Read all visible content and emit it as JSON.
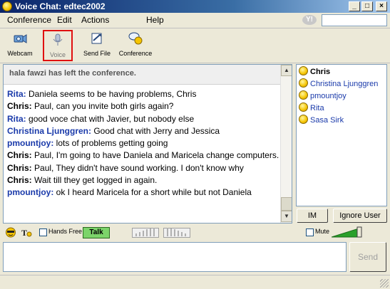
{
  "window": {
    "title": "Voice Chat:  edtec2002",
    "minimize_glyph": "_",
    "maximize_glyph": "□",
    "close_glyph": "×"
  },
  "menu": [
    "Conference",
    "Edit",
    "Actions",
    "Help"
  ],
  "yahoo_logo": "Y!",
  "toolbar": {
    "webcam": "Webcam",
    "voice": "Voice",
    "send_file": "Send File",
    "conference": "Conference"
  },
  "chat": {
    "system_message": "hala fawzi has left the conference.",
    "messages": [
      {
        "sender": "Rita:",
        "text": "Daniela seems to be having problems, Chris",
        "style": "blue"
      },
      {
        "sender": "Chris:",
        "text": "Paul, can you invite both girls again?",
        "style": "black"
      },
      {
        "sender": "Rita:",
        "text": "good voce chat with Javier, but nobody else",
        "style": "blue"
      },
      {
        "sender": "Christina Ljunggren:",
        "text": "Good chat with Jerry and Jessica",
        "style": "blue"
      },
      {
        "sender": "pmountjoy:",
        "text": "lots of problems getting going",
        "style": "blue"
      },
      {
        "sender": "Chris:",
        "text": "Paul, I'm going to have Daniela and Maricela change computers.",
        "style": "black"
      },
      {
        "sender": "Chris:",
        "text": "Paul, They didn't have sound working. I don't know why",
        "style": "black"
      },
      {
        "sender": "Chris:",
        "text": "Wait till they get logged in again.",
        "style": "black"
      },
      {
        "sender": "pmountjoy:",
        "text": "ok I heard Maricela for a short while but not Daniela",
        "style": "blue"
      }
    ]
  },
  "users": [
    {
      "name": "Chris",
      "bold": true
    },
    {
      "name": "Christina Ljunggren",
      "bold": false
    },
    {
      "name": "pmountjoy",
      "bold": false
    },
    {
      "name": "Rita",
      "bold": false
    },
    {
      "name": "Sasa Sirk",
      "bold": false
    }
  ],
  "buttons": {
    "im": "IM",
    "ignore_user": "Ignore User",
    "send": "Send",
    "talk": "Talk"
  },
  "voice": {
    "hands_free": "Hands Free",
    "mute": "Mute"
  }
}
